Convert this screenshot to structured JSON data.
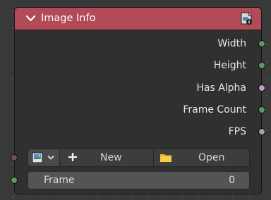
{
  "node": {
    "title": "Image Info",
    "header_color": "#b24b57",
    "collapse_icon": "chevron-down-icon",
    "header_icon": "image-info-icon"
  },
  "outputs": [
    {
      "label": "Width",
      "socket_color": "#5e9a5e"
    },
    {
      "label": "Height",
      "socket_color": "#5e9a5e"
    },
    {
      "label": "Has Alpha",
      "socket_color": "#c49ad0"
    },
    {
      "label": "Frame Count",
      "socket_color": "#5e9a5e"
    },
    {
      "label": "FPS",
      "socket_color": "#a3a3a3"
    }
  ],
  "image_selector": {
    "browse_icon": "image-icon",
    "new_label": "New",
    "new_icon": "plus-icon",
    "open_label": "Open",
    "open_icon": "folder-icon",
    "input_socket_color": "#6b4e6e"
  },
  "frame_field": {
    "label": "Frame",
    "value": "0",
    "input_socket_color": "#5e9a5e"
  }
}
